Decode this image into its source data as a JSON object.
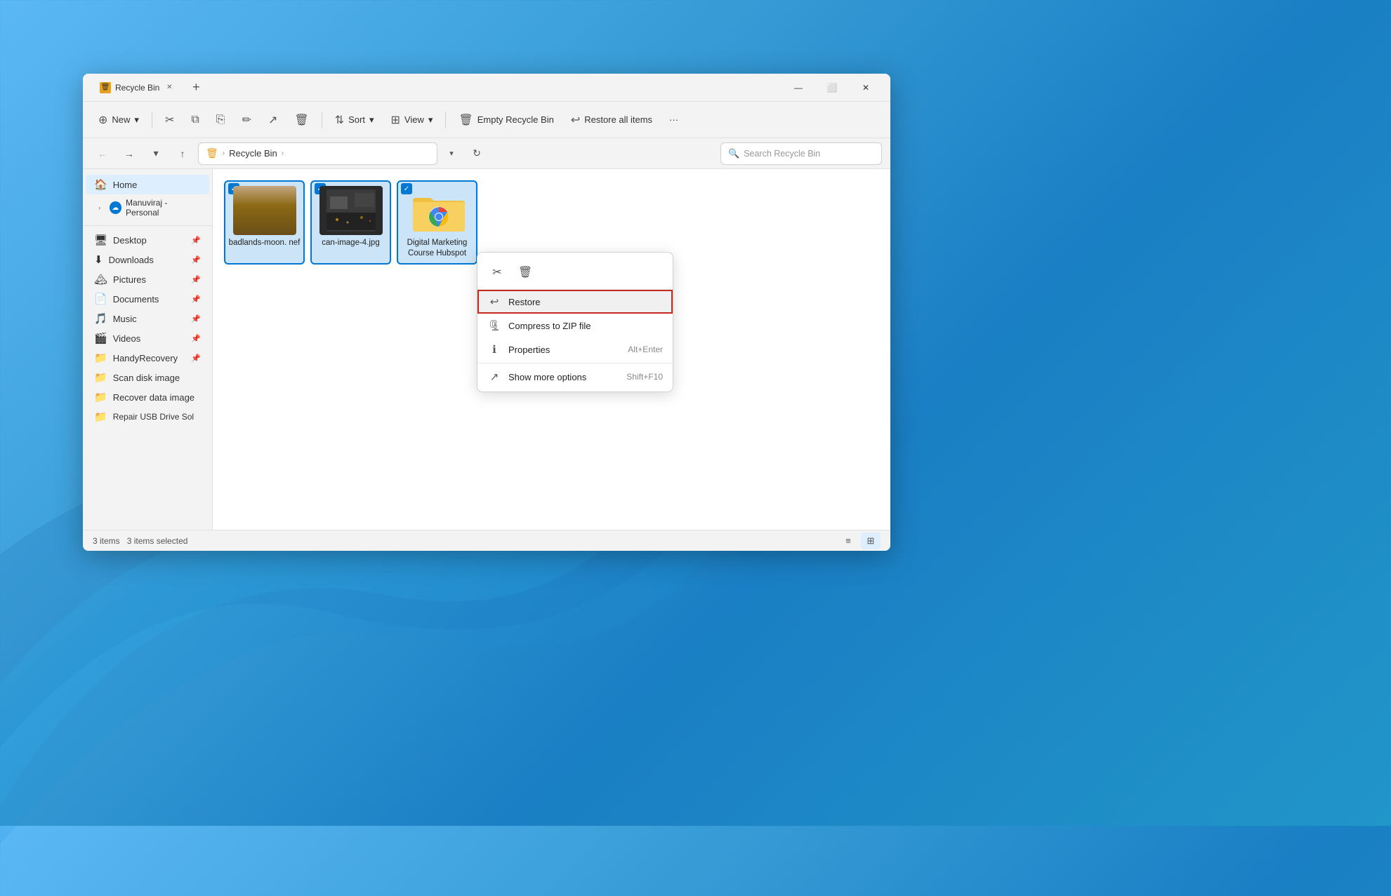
{
  "window": {
    "title": "Recycle Bin",
    "tab_label": "Recycle Bin",
    "tab_new": "+"
  },
  "window_controls": {
    "minimize": "—",
    "maximize": "⬜",
    "close": "✕"
  },
  "toolbar": {
    "new_label": "New",
    "new_arrow": "▾",
    "cut_icon": "✂",
    "copy_icon": "⧉",
    "paste_icon": "📋",
    "rename_icon": "✏",
    "share_icon": "↗",
    "delete_icon": "🗑",
    "sort_label": "Sort",
    "sort_arrow": "▾",
    "view_label": "View",
    "view_arrow": "▾",
    "empty_bin_label": "Empty Recycle Bin",
    "restore_label": "Restore all items",
    "more_icon": "···"
  },
  "address_bar": {
    "back_icon": "←",
    "forward_icon": "→",
    "recent_icon": "▾",
    "up_icon": "↑",
    "path_icon": "🗑",
    "path_segment1": "Recycle Bin",
    "chevron": "›",
    "dropdown_icon": "▾",
    "refresh_icon": "↻",
    "search_placeholder": "Search Recycle Bin",
    "search_icon": "🔍"
  },
  "sidebar": {
    "home_label": "Home",
    "cloud_label": "Manuviraj - Personal",
    "items": [
      {
        "icon": "🖥",
        "label": "Desktop",
        "pinned": true
      },
      {
        "icon": "⬇",
        "label": "Downloads",
        "pinned": true
      },
      {
        "icon": "🏔",
        "label": "Pictures",
        "pinned": true
      },
      {
        "icon": "📄",
        "label": "Documents",
        "pinned": true
      },
      {
        "icon": "🎵",
        "label": "Music",
        "pinned": true
      },
      {
        "icon": "🎬",
        "label": "Videos",
        "pinned": true
      },
      {
        "icon": "📁",
        "label": "HandyRecovery",
        "pinned": true
      },
      {
        "icon": "📁",
        "label": "Scan disk image",
        "pinned": false
      },
      {
        "icon": "📁",
        "label": "Recover data image",
        "pinned": false
      },
      {
        "icon": "📁",
        "label": "Repair USB Drive Sol",
        "pinned": false
      }
    ]
  },
  "files": [
    {
      "id": 1,
      "name": "badlands-moon.\nnef",
      "type": "nef",
      "selected": true
    },
    {
      "id": 2,
      "name": "can-image-4.jpg",
      "type": "jpg",
      "selected": true
    },
    {
      "id": 3,
      "name": "Digital Marketing\nCourse Hubspot",
      "type": "folder",
      "selected": true
    }
  ],
  "context_menu": {
    "cut_icon": "✂",
    "delete_icon": "🗑",
    "restore_icon": "↩",
    "restore_label": "Restore",
    "compress_icon": "🗜",
    "compress_label": "Compress to ZIP file",
    "properties_icon": "ℹ",
    "properties_label": "Properties",
    "properties_shortcut": "Alt+Enter",
    "more_icon": "↗",
    "more_label": "Show more options",
    "more_shortcut": "Shift+F10"
  },
  "status_bar": {
    "items_count": "3 items",
    "selected_text": "3 items selected",
    "list_view_icon": "≡",
    "grid_view_icon": "⊞"
  }
}
